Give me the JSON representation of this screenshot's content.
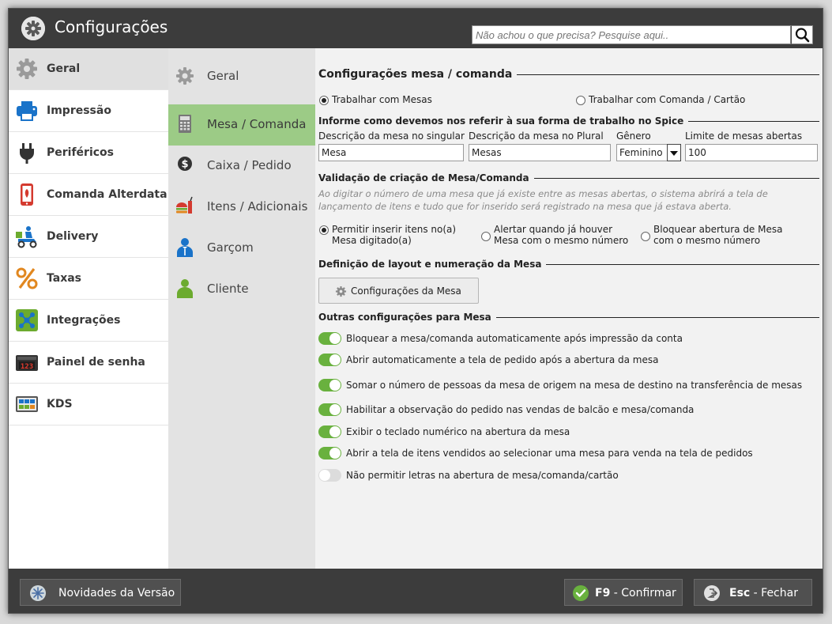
{
  "window": {
    "title": "Configurações"
  },
  "search": {
    "placeholder": "Não achou o que precisa? Pesquise aqui.."
  },
  "nav_primary": [
    {
      "label": "Geral",
      "icon": "gear-icon",
      "active": true
    },
    {
      "label": "Impressão",
      "icon": "printer-icon"
    },
    {
      "label": "Periféricos",
      "icon": "plug-icon"
    },
    {
      "label": "Comanda Alterdata",
      "icon": "mobile-order-icon"
    },
    {
      "label": "Delivery",
      "icon": "delivery-scooter-icon"
    },
    {
      "label": "Taxas",
      "icon": "percent-icon"
    },
    {
      "label": "Integrações",
      "icon": "integration-network-icon"
    },
    {
      "label": "Painel de senha",
      "icon": "ticket-display-icon"
    },
    {
      "label": "KDS",
      "icon": "kitchen-display-icon"
    }
  ],
  "nav_secondary": [
    {
      "label": "Geral",
      "icon": "gear-icon"
    },
    {
      "label": "Mesa / Comanda",
      "icon": "calculator-icon",
      "active": true
    },
    {
      "label": "Caixa / Pedido",
      "icon": "dollar-coin-icon"
    },
    {
      "label": "Itens / Adicionais",
      "icon": "food-icon"
    },
    {
      "label": "Garçom",
      "icon": "waiter-icon"
    },
    {
      "label": "Cliente",
      "icon": "customer-icon"
    }
  ],
  "main": {
    "title": "Configurações mesa / comanda",
    "work_mode": {
      "option_tables": "Trabalhar com Mesas",
      "option_cards": "Trabalhar com Comanda / Cartão",
      "selected": "Trabalhar com Mesas"
    },
    "naming": {
      "title": "Informe como devemos nos referir à sua forma de trabalho no Spice",
      "singular_label": "Descrição da mesa no singular",
      "singular_value": "Mesa",
      "plural_label": "Descrição da mesa no Plural",
      "plural_value": "Mesas",
      "gender_label": "Gênero",
      "gender_value": "Feminino",
      "limit_label": "Limite de mesas abertas",
      "limit_value": "100"
    },
    "validation": {
      "title": "Validação de criação de Mesa/Comanda",
      "description": "Ao digitar o número de uma mesa que já existe entre as mesas abertas, o sistema abrirá a tela de lançamento de itens e tudo que for inserido será registrado na mesa que já estava aberta.",
      "opt1": "Permitir inserir itens no(a) Mesa digitado(a)",
      "opt2": "Alertar quando já houver Mesa com o mesmo número",
      "opt3": "Bloquear abertura de Mesa com o mesmo número",
      "selected": "Permitir inserir itens no(a) Mesa digitado(a)"
    },
    "layout": {
      "title": "Definição de layout e numeração da Mesa",
      "button": "Configurações da Mesa"
    },
    "others": {
      "title": "Outras configurações para Mesa",
      "toggles": [
        {
          "label": "Bloquear a mesa/comanda automaticamente após impressão da conta",
          "on": true
        },
        {
          "label": "Abrir automaticamente a tela de pedido após a abertura da mesa",
          "on": true
        },
        {
          "label": "Somar o número de pessoas da mesa de origem na mesa de destino na transferência de mesas",
          "on": true
        },
        {
          "label": "Habilitar a observação do pedido nas vendas de balcão e mesa/comanda",
          "on": true
        },
        {
          "label": "Exibir o teclado numérico na abertura da mesa",
          "on": true
        },
        {
          "label": "Abrir a tela de itens vendidos ao selecionar uma mesa para venda na tela de pedidos",
          "on": true
        },
        {
          "label": "Não permitir letras na abertura de mesa/comanda/cartão",
          "on": false
        }
      ]
    }
  },
  "footer": {
    "news_label": "Novidades da Versão",
    "confirm_key": "F9",
    "confirm_sep": " - ",
    "confirm_label": "Confirmar",
    "close_key": "Esc",
    "close_sep": " - ",
    "close_label": "Fechar"
  },
  "colors": {
    "accent_green": "#69b13e",
    "active_nav": "#9ccb86",
    "titlebar": "#3c3c3c"
  }
}
